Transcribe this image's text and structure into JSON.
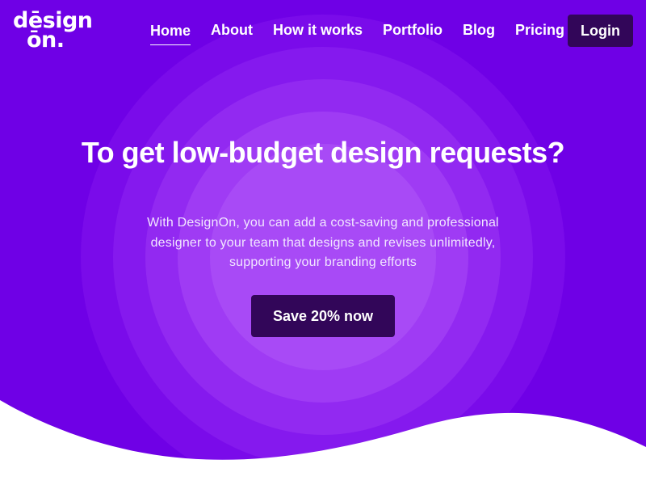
{
  "brand": {
    "logo_line1": "dēsign",
    "logo_line2": "ōn."
  },
  "nav": {
    "items": [
      {
        "label": "Home",
        "active": true
      },
      {
        "label": "About"
      },
      {
        "label": "How it works"
      },
      {
        "label": "Portfolio"
      },
      {
        "label": "Blog"
      },
      {
        "label": "Pricing"
      }
    ],
    "login_label": "Login"
  },
  "hero": {
    "title": "To get low-budget design requests?",
    "subtitle": "With DesignOn, you can add a cost-saving and professional designer to your team that designs and revises unlimitedly, supporting your branding efforts",
    "cta_label": "Save 20% now"
  },
  "colors": {
    "background": "#6f00e6",
    "button": "#320659",
    "text": "#ffffff"
  }
}
